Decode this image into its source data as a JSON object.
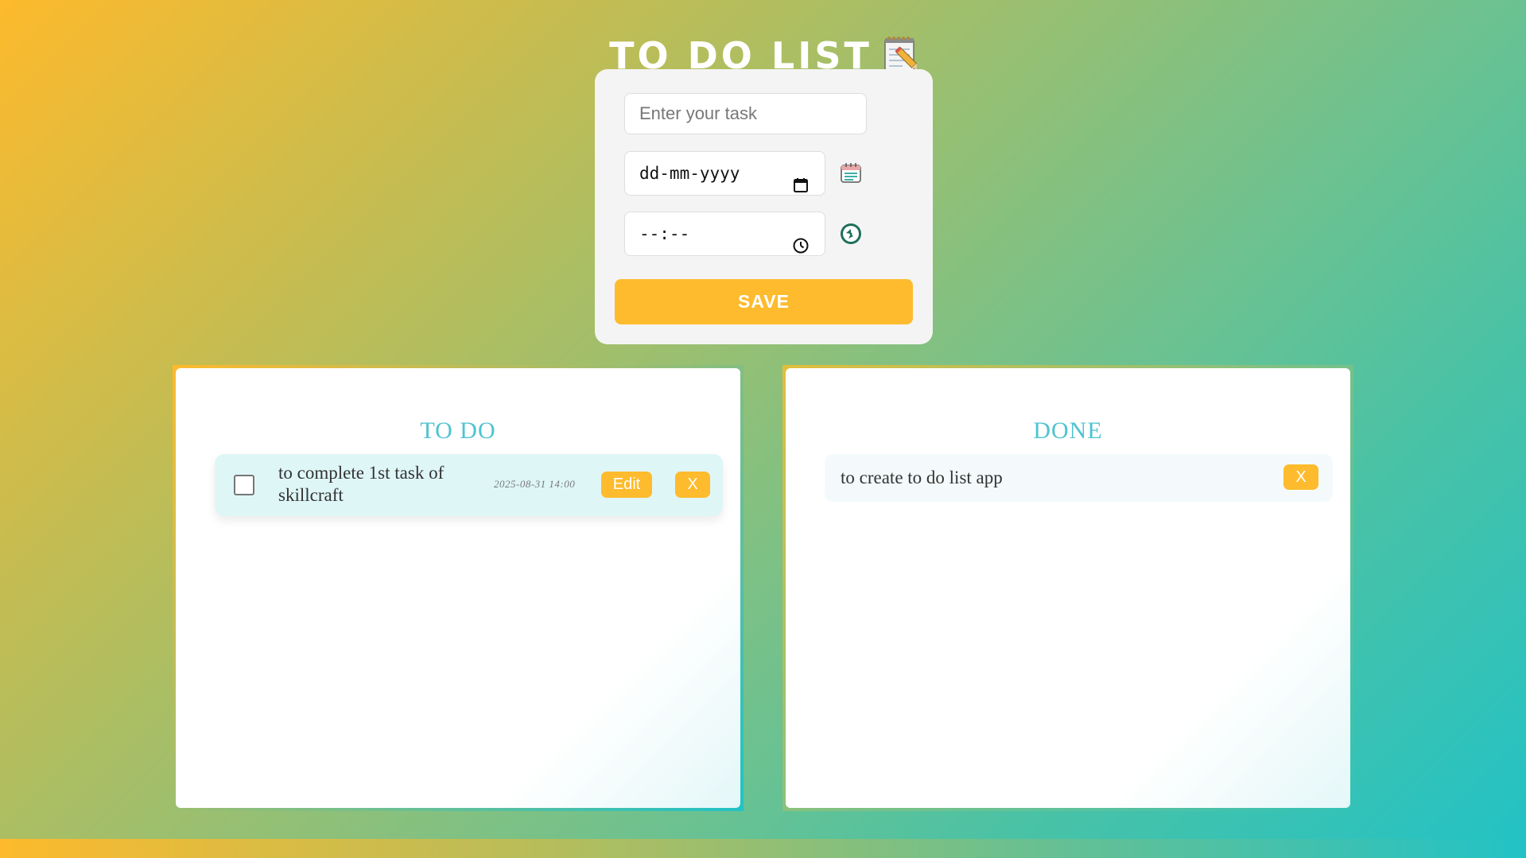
{
  "header": {
    "title": "TO DO LIST",
    "icon": "notepad-pencil-icon"
  },
  "form": {
    "task_placeholder": "Enter your task",
    "date_placeholder": "dd-mm-yyyy",
    "time_placeholder": "--:--",
    "date_side_icon": "calendar-icon",
    "time_side_icon": "clock-icon",
    "save_label": "SAVE"
  },
  "todo": {
    "heading": "TO DO",
    "items": [
      {
        "text": "to complete 1st task of skillcraft",
        "datetime": "2025-08-31 14:00",
        "checked": false,
        "edit_label": "Edit",
        "delete_label": "X"
      }
    ]
  },
  "done": {
    "heading": "DONE",
    "items": [
      {
        "text": "to create to do list app",
        "delete_label": "X"
      }
    ]
  },
  "colors": {
    "accent": "#fdbb2d",
    "heading": "#4fc3d0",
    "gradient_start": "#fdba2c",
    "gradient_end": "#22c2c6"
  }
}
